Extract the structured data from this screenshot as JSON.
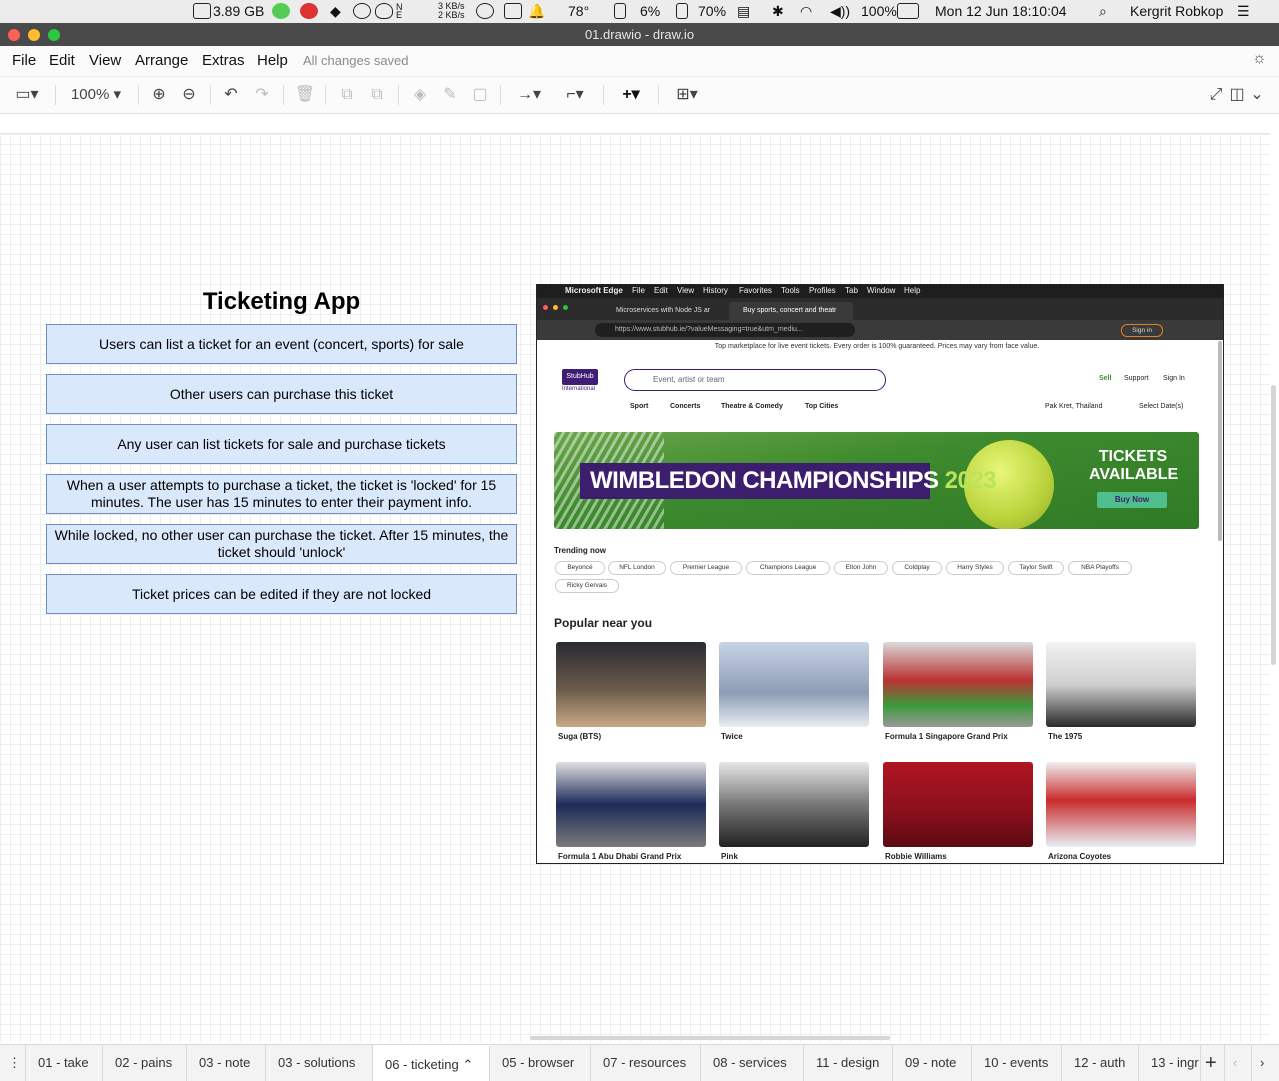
{
  "macos_menubar": {
    "disk": "3.89 GB",
    "network_up": "3 KB/s",
    "network_down": "2 KB/s",
    "temperature": "78°",
    "cpu": "6%",
    "memory": "70%",
    "battery": "100%",
    "datetime": "Mon 12 Jun  18:10:04",
    "user": "Kergrit Robkop"
  },
  "window": {
    "title": "01.drawio - draw.io"
  },
  "menu": {
    "items": [
      "File",
      "Edit",
      "View",
      "Arrange",
      "Extras",
      "Help"
    ],
    "status": "All changes saved"
  },
  "toolbar": {
    "zoom": "100%"
  },
  "diagram": {
    "title": "Ticketing App",
    "requirements": [
      "Users can list a ticket for an event (concert, sports) for sale",
      "Other users can purchase this ticket",
      "Any user can list tickets for sale and purchase tickets",
      "When a user attempts to purchase a ticket, the ticket is 'locked' for 15 minutes.  The user has 15 minutes to enter their payment info.",
      "While locked, no other user can purchase the ticket. After 15 minutes, the ticket should 'unlock'",
      "Ticket prices can be edited if they are not locked"
    ],
    "colors": {
      "box_fill": "#dae8fc",
      "box_stroke": "#6c8ebf"
    }
  },
  "screenshot": {
    "menubar": [
      "Microsoft Edge",
      "File",
      "Edit",
      "View",
      "History",
      "Favorites",
      "Tools",
      "Profiles",
      "Tab",
      "Window",
      "Help"
    ],
    "tabs": [
      "Microservices with Node JS ar",
      "Buy sports, concert and theatr"
    ],
    "url": "https://www.stubhub.ie/?valueMessaging=true&utm_mediu...",
    "signin_button": "Sign in",
    "top_banner": "Top marketplace for live event tickets. Every order is 100% guaranteed. Prices may vary from face value.",
    "logo": "StubHub",
    "logo_sub": "International",
    "search_placeholder": "Event, artist or team",
    "header_links": [
      "Sell",
      "Support",
      "Sign In"
    ],
    "nav": [
      "Sport",
      "Concerts",
      "Theatre & Comedy",
      "Top Cities"
    ],
    "location": "Pak Kret, Thailand",
    "date_select": "Select Date(s)",
    "hero": {
      "title": "WIMBLEDON CHAMPIONSHIPS",
      "year": "2023",
      "tickets": "TICKETS AVAILABLE",
      "cta": "Buy Now"
    },
    "trending_heading": "Trending now",
    "trending": [
      "Beyoncé",
      "NFL London",
      "Premier League",
      "Champions League",
      "Elton John",
      "Coldplay",
      "Harry Styles",
      "Taylor Swift",
      "NBA Playoffs",
      "Ricky Gervais"
    ],
    "popular_heading": "Popular near you",
    "popular": [
      "Suga (BTS)",
      "Twice",
      "Formula 1 Singapore Grand Prix",
      "The 1975",
      "Formula 1 Abu Dhabi Grand Prix",
      "Pink",
      "Robbie Williams",
      "Arizona Coyotes"
    ]
  },
  "pages": [
    "01 - take",
    "02 - pains",
    "03 - note",
    "03 - solutions",
    "06 - ticketing",
    "05 - browser",
    "07 - resources",
    "08 - services",
    "11 - design",
    "09 - note",
    "10 - events",
    "12 - auth",
    "13 - ingr"
  ],
  "active_page": "06 - ticketing"
}
